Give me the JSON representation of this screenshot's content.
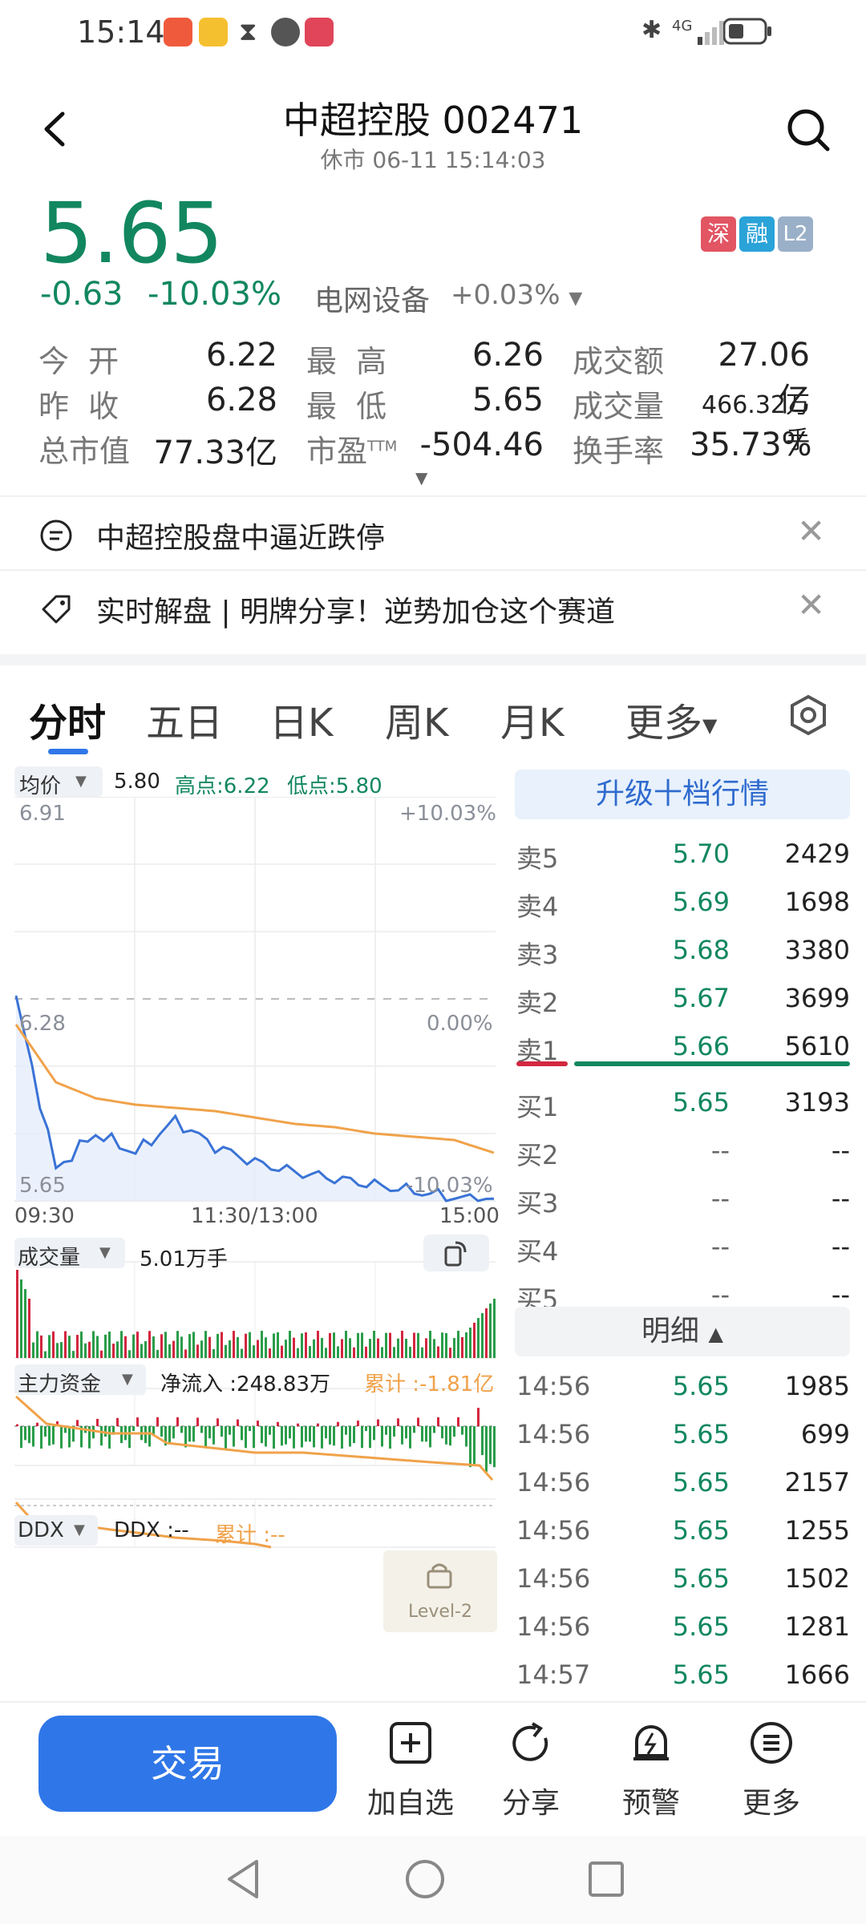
{
  "status_bar": {
    "time": "15:14",
    "network": "4G"
  },
  "header": {
    "title": "中超控股 002471",
    "subtitle": "休市 06-11 15:14:03"
  },
  "price": {
    "last": "5.65",
    "change": "-0.63",
    "change_pct": "-10.03%",
    "sector": "电网设备",
    "sector_pct": "+0.03%"
  },
  "badges": {
    "shen": "深",
    "rong": "融",
    "l2": "L2"
  },
  "stats": {
    "open_label": "今 开",
    "open": "6.22",
    "prev_label": "昨 收",
    "prev": "6.28",
    "mcap_label": "总市值",
    "mcap": "77.33亿",
    "high_label": "最 高",
    "high": "6.26",
    "low_label": "最 低",
    "low": "5.65",
    "pe_label": "市盈",
    "pe_sup": "TTM",
    "pe": "-504.46",
    "turnover_amt_label": "成交额",
    "turnover_amt": "27.06亿",
    "volume_label": "成交量",
    "volume": "466.32万手",
    "turnover_rate_label": "换手率",
    "turnover_rate": "35.73%"
  },
  "news": [
    {
      "text": "中超控股盘中逼近跌停",
      "close": "✕"
    },
    {
      "text": "实时解盘 | 明牌分享！逆势加仓这个赛道",
      "close": "✕"
    }
  ],
  "tabs": [
    "分时",
    "五日",
    "日K",
    "周K",
    "月K",
    "更多"
  ],
  "chart_header": {
    "avg_label": "均价",
    "avg_value": "5.80",
    "high": "高点:6.22",
    "low": "低点:5.80"
  },
  "chart_axis": {
    "y_top": "6.91",
    "y_mid": "6.28",
    "y_bot": "5.65",
    "pct_top": "+10.03%",
    "pct_mid": "0.00%",
    "pct_bot": "-10.03%",
    "x_start": "09:30",
    "x_mid": "11:30/13:00",
    "x_end": "15:00"
  },
  "volume_panel": {
    "label": "成交量",
    "value": "5.01万手"
  },
  "capital_panel": {
    "label": "主力资金",
    "net_label": "净流入 :248.83万",
    "cum_label": "累计 :-1.81亿"
  },
  "ddx_panel": {
    "label": "DDX",
    "ddx_value": "DDX :--",
    "cum_label": "累计 :--",
    "lock_text": "Level-2"
  },
  "orderbook": {
    "upgrade": "升级十档行情",
    "asks": [
      {
        "name": "卖5",
        "price": "5.70",
        "vol": "2429"
      },
      {
        "name": "卖4",
        "price": "5.69",
        "vol": "1698"
      },
      {
        "name": "卖3",
        "price": "5.68",
        "vol": "3380"
      },
      {
        "name": "卖2",
        "price": "5.67",
        "vol": "3699"
      },
      {
        "name": "卖1",
        "price": "5.66",
        "vol": "5610"
      }
    ],
    "bids": [
      {
        "name": "买1",
        "price": "5.65",
        "vol": "3193"
      },
      {
        "name": "买2",
        "price": "--",
        "vol": "--"
      },
      {
        "name": "买3",
        "price": "--",
        "vol": "--"
      },
      {
        "name": "买4",
        "price": "--",
        "vol": "--"
      },
      {
        "name": "买5",
        "price": "--",
        "vol": "--"
      }
    ],
    "detail_header": "明细",
    "details": [
      {
        "time": "14:56",
        "price": "5.65",
        "vol": "1985"
      },
      {
        "time": "14:56",
        "price": "5.65",
        "vol": "699"
      },
      {
        "time": "14:56",
        "price": "5.65",
        "vol": "2157"
      },
      {
        "time": "14:56",
        "price": "5.65",
        "vol": "1255"
      },
      {
        "time": "14:56",
        "price": "5.65",
        "vol": "1502"
      },
      {
        "time": "14:56",
        "price": "5.65",
        "vol": "1281"
      },
      {
        "time": "14:57",
        "price": "5.65",
        "vol": "1666"
      }
    ]
  },
  "bottom_bar": {
    "trade": "交易",
    "watchlist": "加自选",
    "share": "分享",
    "alert": "预警",
    "more": "更多"
  },
  "chart_data": {
    "type": "line",
    "x": [
      "09:30",
      "11:30/13:00",
      "15:00"
    ],
    "series": [
      {
        "values": [
          6.28,
          5.75,
          5.86,
          5.8,
          5.9,
          5.82,
          5.77,
          5.74,
          5.72,
          5.7,
          5.68,
          5.66,
          5.65
        ]
      },
      {
        "values": [
          6.2,
          6.02,
          5.97,
          5.95,
          5.94,
          5.93,
          5.91,
          5.89,
          5.88,
          5.86,
          5.85,
          5.84,
          5.8
        ]
      }
    ],
    "ylim": [
      5.65,
      6.91
    ],
    "colors": [
      "#3a73d6",
      "#f0a24a"
    ]
  }
}
